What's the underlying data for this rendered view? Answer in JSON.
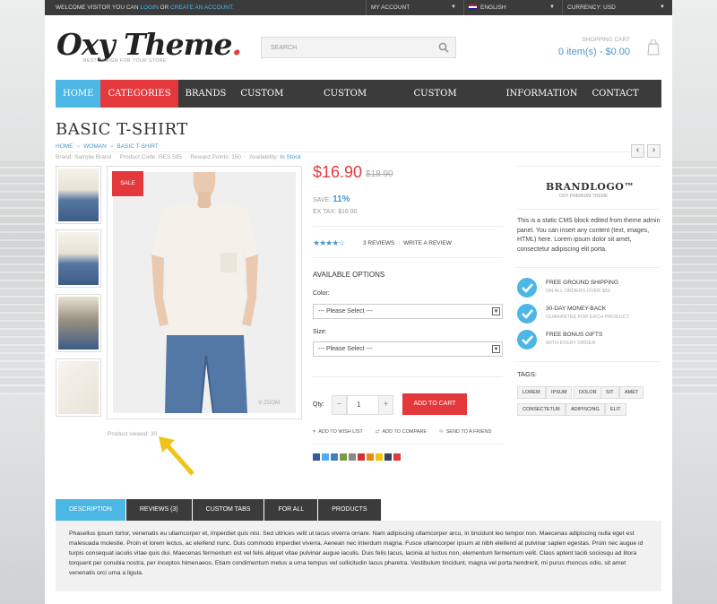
{
  "topbar": {
    "welcome_prefix": "WELCOME VISITOR YOU CAN",
    "login": "LOGIN",
    "or": "OR",
    "create": "CREATE AN ACCOUNT.",
    "account": "MY ACCOUNT",
    "language": "ENGLISH",
    "currency": "CURRENCY: USD"
  },
  "logo": {
    "text": "Oxy Theme",
    "dot": ".",
    "tagline": "BEST DESIGN FOR YOUR STORE"
  },
  "search": {
    "placeholder": "SEARCH"
  },
  "cart": {
    "label": "SHOPPING CART",
    "value": "0 item(s) - $0.00"
  },
  "nav": [
    "HOME",
    "CATEGORIES",
    "BRANDS",
    "CUSTOM LINK",
    "CUSTOM MENU",
    "CUSTOM BLOCK",
    "INFORMATION",
    "CONTACT US"
  ],
  "product": {
    "title": "BASIC T-SHIRT",
    "breadcrumb": [
      "HOME",
      "WOMAN",
      "BASIC T-SHIRT"
    ],
    "meta": {
      "brand": "Brand: Sample Brand",
      "code": "Product Code: RES.595",
      "points": "Reward Points: 150",
      "availability_label": "Availability:",
      "availability": "In Stock"
    },
    "sale": "SALE",
    "zoom": "ZOOM",
    "viewed": "Product viewed: 30",
    "price": "$16.90",
    "old_price": "$18.90",
    "save_label": "SAVE:",
    "save_pct": "11%",
    "ex_tax": "EX TAX: $16.90",
    "rating": 4,
    "stars": "★★★★☆",
    "reviews": "3 REVIEWS",
    "write_review": "WRITE A REVIEW",
    "options_title": "AVAILABLE OPTIONS",
    "color_label": "Color:",
    "color_value": "--- Please Select ---",
    "size_label": "Size:",
    "size_value": "--- Please Select ---",
    "qty_label": "Qty:",
    "qty": "1",
    "add_to_cart": "ADD TO CART",
    "wishlist": "ADD TO WISH LIST",
    "compare": "ADD TO COMPARE",
    "friend": "SEND TO A FRIEND"
  },
  "sidebar": {
    "brand_logo": "BRANDLOGO™",
    "brand_sub": "OXY PREMIUM THEME",
    "cms": "This is a static CMS block edited from theme admin panel. You can insert any content (text, images, HTML) here. Lorem ipsum dolor sit amet, consectetur adipiscing elit porta.",
    "features": [
      {
        "title": "FREE GROUND SHIPPING",
        "sub": "ON ALL ORDERS OVER $50"
      },
      {
        "title": "30-DAY MONEY-BACK",
        "sub": "GUARANTEE FOR EACH PRODUCT"
      },
      {
        "title": "FREE BONUS GIFTS",
        "sub": "WITH EVERY ORDER"
      }
    ],
    "tags_title": "TAGS:",
    "tags": [
      "LOREM",
      "IPSUM",
      "DOLOR",
      "SIT",
      "AMET",
      "CONSECTETUR",
      "ADIPISCING",
      "ELIT"
    ]
  },
  "tabs": [
    "DESCRIPTION",
    "REVIEWS (3)",
    "CUSTOM TABS",
    "FOR ALL",
    "PRODUCTS"
  ],
  "description": "Phasellus ipsum tortor, venenatis eu ullamcorper et, imperdiet quis nisi. Sed ultrices velit ut lacus viverra ornare. Nam adipiscing ullamcorper arcu, in tincidunt leo tempor non. Maecenas adipiscing nulla eget est malesuada molestie. Proin et lorem lectus, ac eleifend nunc. Duis commodo imperdiet viverra. Aenean nec interdum magna. Fusce ullamcorper ipsum at nibh eleifend at pulvinar sapien egestas. Proin nec augue id turpis consequat iaculis vitae quis dui. Maecenas fermentum est vel felis aliquet vitae pulvinar augue iaculis. Duis felis lacus, lacinia at luctus non, elementum fermentum velit. Class aptent taciti sociosqu ad litora torquent per conubia nostra, per inceptos himenaeos. Etiam condimentum metus a urna tempus vel sollicitudin lacus pharetra. Vestibulum tincidunt, magna vel porta hendrerit, mi purus rhoncus odio, sit amet venenatis orci urna a ligula.",
  "colors": {
    "accent_blue": "#4cb6e4",
    "accent_red": "#e4393c",
    "dark": "#3b3b3b"
  }
}
